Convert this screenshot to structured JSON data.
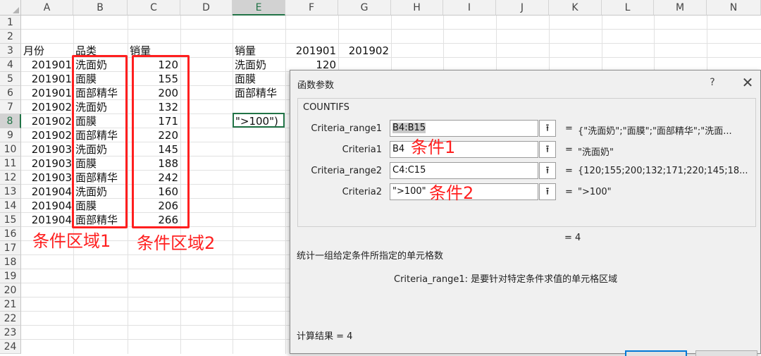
{
  "columns": [
    "A",
    "B",
    "C",
    "D",
    "E",
    "F",
    "G",
    "H",
    "I",
    "J",
    "K",
    "L",
    "M",
    "N"
  ],
  "rows": [
    "1",
    "2",
    "3",
    "4",
    "5",
    "6",
    "7",
    "8",
    "9",
    "10",
    "11",
    "12",
    "13",
    "14",
    "15",
    "16",
    "17",
    "18",
    "19",
    "20",
    "21",
    "22",
    "23",
    "24"
  ],
  "headers": {
    "a3": "月份",
    "b3": "品类",
    "c3": "销量",
    "e3": "销量",
    "f3": "201901",
    "g3": "201902"
  },
  "data_rows": [
    {
      "month": "201901",
      "category": "洗面奶",
      "sales": "120"
    },
    {
      "month": "201901",
      "category": "面膜",
      "sales": "155"
    },
    {
      "month": "201901",
      "category": "面部精华",
      "sales": "200"
    },
    {
      "month": "201902",
      "category": "洗面奶",
      "sales": "132"
    },
    {
      "month": "201902",
      "category": "面膜",
      "sales": "171"
    },
    {
      "month": "201902",
      "category": "面部精华",
      "sales": "220"
    },
    {
      "month": "201903",
      "category": "洗面奶",
      "sales": "145"
    },
    {
      "month": "201903",
      "category": "面膜",
      "sales": "188"
    },
    {
      "month": "201903",
      "category": "面部精华",
      "sales": "242"
    },
    {
      "month": "201904",
      "category": "洗面奶",
      "sales": "160"
    },
    {
      "month": "201904",
      "category": "面膜",
      "sales": "206"
    },
    {
      "month": "201904",
      "category": "面部精华",
      "sales": "266"
    }
  ],
  "summary": {
    "e4": "洗面奶",
    "e5": "面膜",
    "e6": "面部精华",
    "f4": "120",
    "e8": "\">100\")"
  },
  "annotations": {
    "region1": "条件区域1",
    "region2": "条件区域2",
    "cond1": "条件1",
    "cond2": "条件2"
  },
  "dialog": {
    "title": "函数参数",
    "help": "?",
    "close": "✕",
    "function_name": "COUNTIFS",
    "args": [
      {
        "label": "Criteria_range1",
        "input": "B4:B15",
        "value": "{\"洗面奶\";\"面膜\";\"面部精华\";\"洗面..."
      },
      {
        "label": "Criteria1",
        "input": "B4",
        "value": "\"洗面奶\""
      },
      {
        "label": "Criteria_range2",
        "input": "C4:C15",
        "value": "{120;155;200;132;171;220;145;18..."
      },
      {
        "label": "Criteria2",
        "input": "\">100\"",
        "value": "\">100\""
      }
    ],
    "ref_btn": "⭱",
    "eq": "=",
    "overall": "=   4",
    "description": "统计一组给定条件所指定的单元格数",
    "arg_help": "Criteria_range1:  是要针对特定条件求值的单元格区域",
    "result": "计算结果 =   4"
  },
  "colors": {
    "annotation": "#ff1f1f",
    "excel_green": "#217346",
    "ok_border": "#0078d7"
  }
}
